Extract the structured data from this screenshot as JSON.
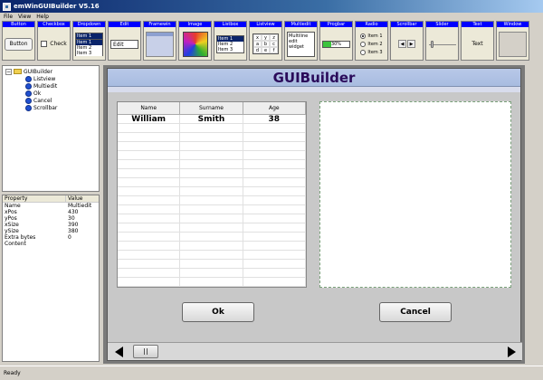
{
  "window": {
    "title": "emWinGUIBuilder V5.16"
  },
  "menu": [
    "File",
    "View",
    "Help"
  ],
  "toolbox": [
    {
      "label": "Button",
      "content": "Button"
    },
    {
      "label": "Checkbox",
      "content": "Check"
    },
    {
      "label": "Dropdown",
      "options": [
        "Item 1",
        "Item 1",
        "Item 2",
        "Item 3"
      ]
    },
    {
      "label": "Edit",
      "content": "Edit"
    },
    {
      "label": "Framewin"
    },
    {
      "label": "Image"
    },
    {
      "label": "Listbox",
      "items": [
        "Item 1",
        "Item 2",
        "Item 3"
      ]
    },
    {
      "label": "Listview",
      "cells": [
        "x",
        "y",
        "z",
        "a",
        "b",
        "c",
        "d",
        "e",
        "f"
      ]
    },
    {
      "label": "Multiedit",
      "lines": [
        "Multiline",
        "edit",
        "widget"
      ]
    },
    {
      "label": "Progbar",
      "content": "30%",
      "value": 0.3
    },
    {
      "label": "Radio",
      "items": [
        "Item 1",
        "Item 2",
        "Item 3"
      ]
    },
    {
      "label": "Scrollbar"
    },
    {
      "label": "Slider"
    },
    {
      "label": "Text",
      "content": "Text"
    },
    {
      "label": "Window"
    }
  ],
  "tree": {
    "root": "GUIBuilder",
    "children": [
      "Listview",
      "Multiedit",
      "Ok",
      "Cancel",
      "Scrollbar"
    ]
  },
  "properties": {
    "headers": [
      "Property",
      "Value"
    ],
    "rows": [
      [
        "Name",
        "Multiedit"
      ],
      [
        "xPos",
        "430"
      ],
      [
        "yPos",
        "30"
      ],
      [
        "xSize",
        "390"
      ],
      [
        "ySize",
        "380"
      ],
      [
        "Extra bytes",
        "0"
      ],
      [
        "Content",
        ""
      ]
    ]
  },
  "form": {
    "title": "GUIBuilder",
    "listview": {
      "headers": [
        "Name",
        "Surname",
        "Age"
      ],
      "rows": [
        [
          "William",
          "Smith",
          "38"
        ]
      ]
    },
    "ok_label": "Ok",
    "cancel_label": "Cancel"
  },
  "status": "Ready"
}
